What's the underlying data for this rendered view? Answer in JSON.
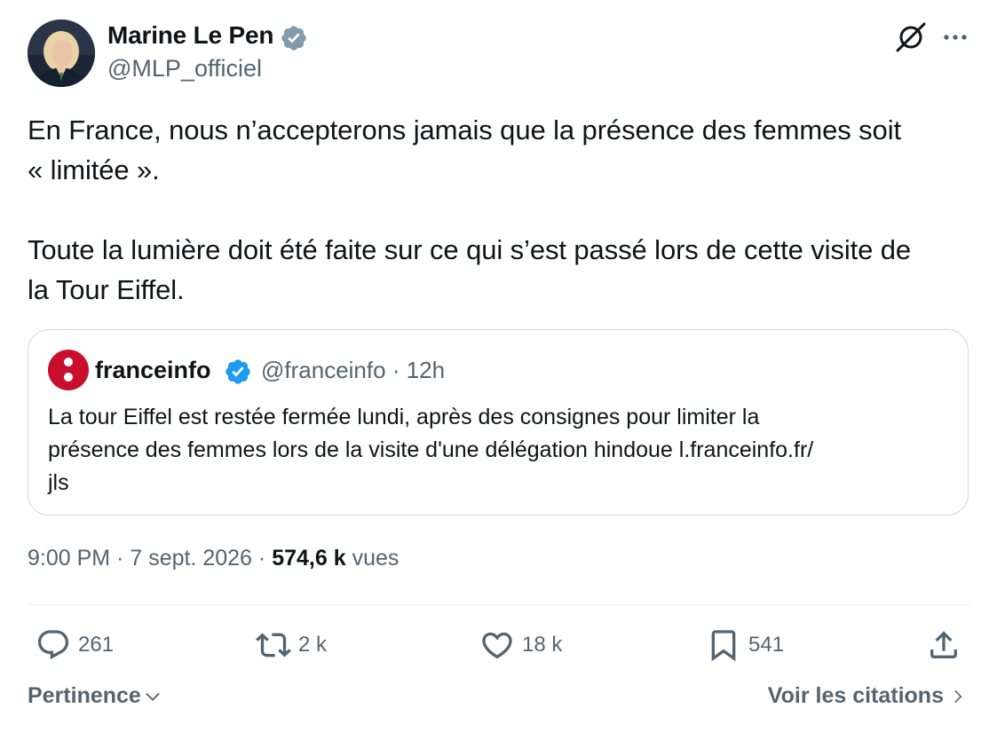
{
  "author": {
    "name": "Marine Le Pen",
    "handle": "@MLP_officiel",
    "verified": true
  },
  "tweet": {
    "paragraphs": [
      [
        "En France, nous n’accepterons jamais que la présence des femmes soit",
        "« limitée »."
      ],
      [
        "Toute la lumière doit été faite sur ce qui s’est passé lors de cette visite de",
        "la Tour Eiffel."
      ]
    ]
  },
  "quoted_tweet": {
    "name": "franceinfo",
    "handle": "@franceinfo",
    "separator": "·",
    "time": "12h",
    "verified": true,
    "text_lines": [
      "La tour Eiffel est restée fermée lundi, après des consignes pour limiter la",
      "présence des femmes lors de la visite d'une délégation hindoue l.franceinfo.fr/",
      "jls"
    ]
  },
  "meta": {
    "time": "9:00 PM",
    "separator": "·",
    "date": "7 sept. 2026",
    "views_count": "574,6 k",
    "views_label": "vues"
  },
  "actions": {
    "replies": "261",
    "reposts": "2 k",
    "likes": "18 k",
    "bookmarks": "541"
  },
  "footer": {
    "sort_label": "Pertinence",
    "quotes_label": "Voir les citations"
  },
  "icons": {
    "verified": "verified-badge-icon",
    "grok": "grok-icon",
    "more": "more-options-icon",
    "reply": "reply-icon",
    "repost": "repost-icon",
    "like": "heart-icon",
    "bookmark": "bookmark-icon",
    "share": "share-icon"
  },
  "colors": {
    "text_primary": "#0f1419",
    "text_secondary": "#536471",
    "verified_blue": "#1d9bf0",
    "franceinfo_red": "#c8102e",
    "border": "#cfd9de"
  }
}
